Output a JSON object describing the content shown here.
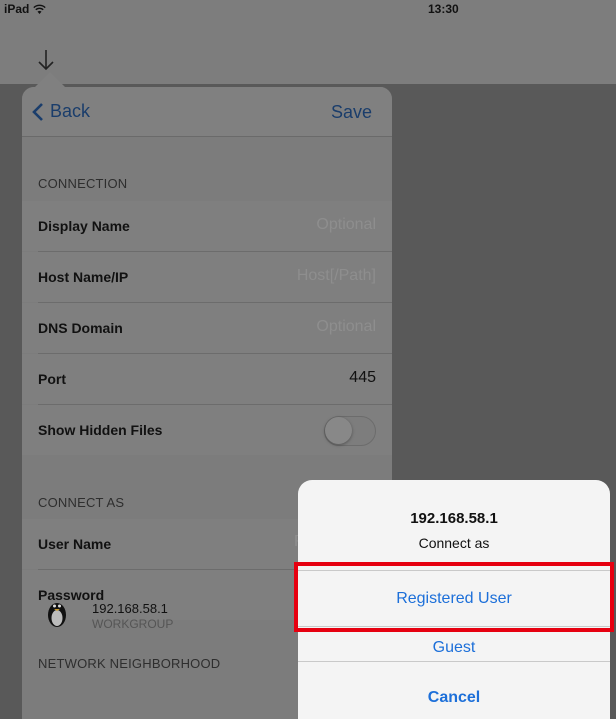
{
  "status_bar": {
    "device": "iPad",
    "time": "13:30"
  },
  "nav": {
    "back_label": "Back",
    "save_label": "Save"
  },
  "connection": {
    "header": "CONNECTION",
    "rows": [
      {
        "label": "Display Name",
        "value": "Optional"
      },
      {
        "label": "Host Name/IP",
        "value": "Host[/Path]"
      },
      {
        "label": "DNS Domain",
        "value": "Optional"
      },
      {
        "label": "Port",
        "value": "445"
      },
      {
        "label": "Show Hidden Files"
      }
    ],
    "show_hidden_files": false
  },
  "connect_as": {
    "header": "CONNECT AS",
    "rows": [
      {
        "label": "User Name",
        "value": "R"
      },
      {
        "label": "Password"
      }
    ]
  },
  "network_neighborhood": {
    "header": "NETWORK NEIGHBORHOOD",
    "items": [
      {
        "title": "192.168.58.1",
        "subtitle": "WORKGROUP"
      }
    ]
  },
  "action_sheet": {
    "title": "192.168.58.1",
    "subtitle": "Connect as",
    "actions": [
      "Registered User",
      "Guest",
      "Cancel"
    ]
  },
  "colors": {
    "accent": "#1c6fd9",
    "highlight": "#e60010"
  },
  "icons": [
    "wifi-icon",
    "download-icon",
    "back-chevron-icon",
    "tux-icon"
  ]
}
